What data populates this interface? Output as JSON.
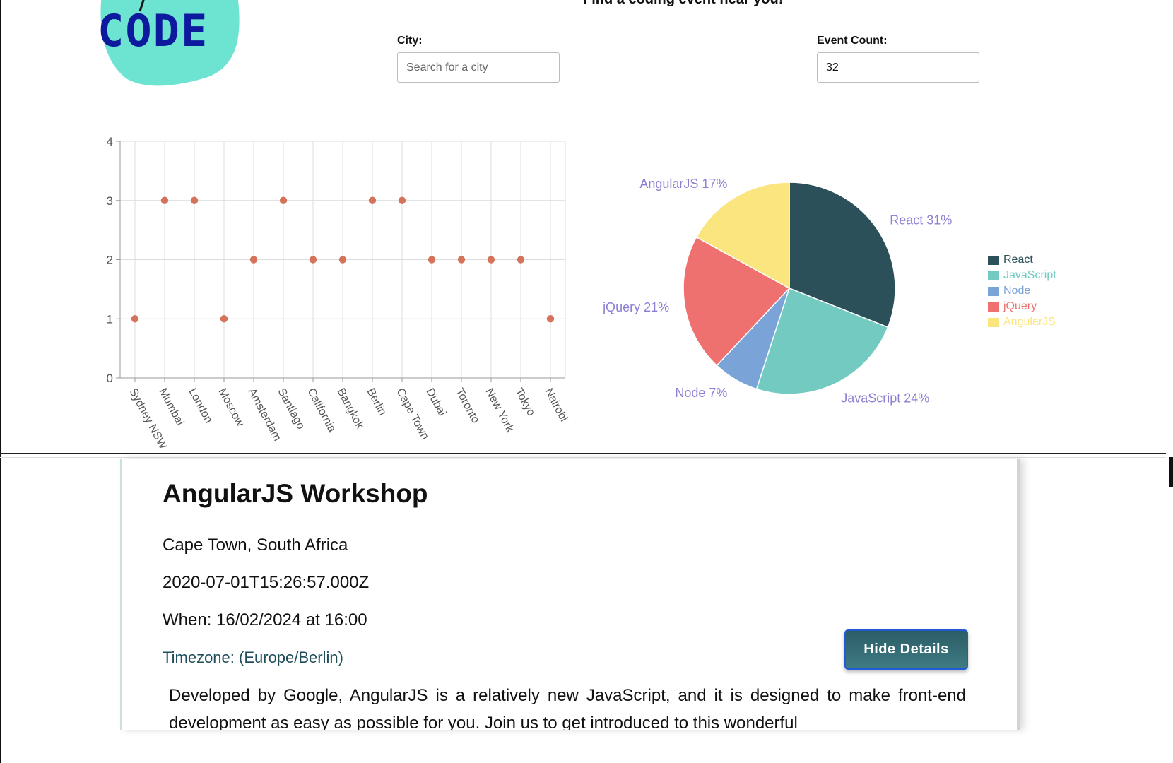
{
  "header": {
    "logo_text": "CODE",
    "tagline": "Find a coding event near you!"
  },
  "search": {
    "city_label": "City:",
    "city_placeholder": "Search for a city",
    "city_value": "",
    "count_label": "Event Count:",
    "count_value": "32"
  },
  "colors": {
    "accent": "#2b5d66",
    "scatter_point": "#d4735a",
    "pie_label": "#8b7fd4"
  },
  "chart_data": [
    {
      "type": "scatter",
      "title": "",
      "xlabel": "",
      "ylabel": "",
      "categories": [
        "Sydney NSW",
        "Mumbai",
        "London",
        "Moscow",
        "Amsterdam",
        "Santiago",
        "California",
        "Bangkok",
        "Berlin",
        "Cape Town",
        "Dubai",
        "Toronto",
        "New York",
        "Tokyo",
        "Nairobi"
      ],
      "values": [
        1,
        3,
        3,
        1,
        2,
        3,
        2,
        2,
        3,
        3,
        2,
        2,
        2,
        2,
        1
      ],
      "ylim": [
        0,
        4
      ],
      "yticks": [
        "0",
        "1",
        "2",
        "3",
        "4"
      ],
      "grid": true
    },
    {
      "type": "pie",
      "title": "",
      "legend": "right",
      "slices": [
        {
          "name": "React",
          "value": 31,
          "label": "React 31%",
          "color": "#2b5059"
        },
        {
          "name": "JavaScript",
          "value": 24,
          "label": "JavaScript 24%",
          "color": "#72cac0"
        },
        {
          "name": "Node",
          "value": 7,
          "label": "Node 7%",
          "color": "#7aa4d8"
        },
        {
          "name": "jQuery",
          "value": 21,
          "label": "jQuery 21%",
          "color": "#ee7170"
        },
        {
          "name": "AngularJS",
          "value": 17,
          "label": "AngularJS 17%",
          "color": "#fbe57e"
        }
      ]
    }
  ],
  "event": {
    "title": "AngularJS Workshop",
    "location": "Cape Town, South Africa",
    "datetime": "2020-07-01T15:26:57.000Z",
    "when": "When: 16/02/2024 at 16:00",
    "timezone": "Timezone: (Europe/Berlin)",
    "hide_button": "Hide Details",
    "description": "Developed by Google, AngularJS is a relatively new JavaScript, and it is designed to make front-end development as easy as possible for you. Join us to get introduced to this wonderful"
  }
}
